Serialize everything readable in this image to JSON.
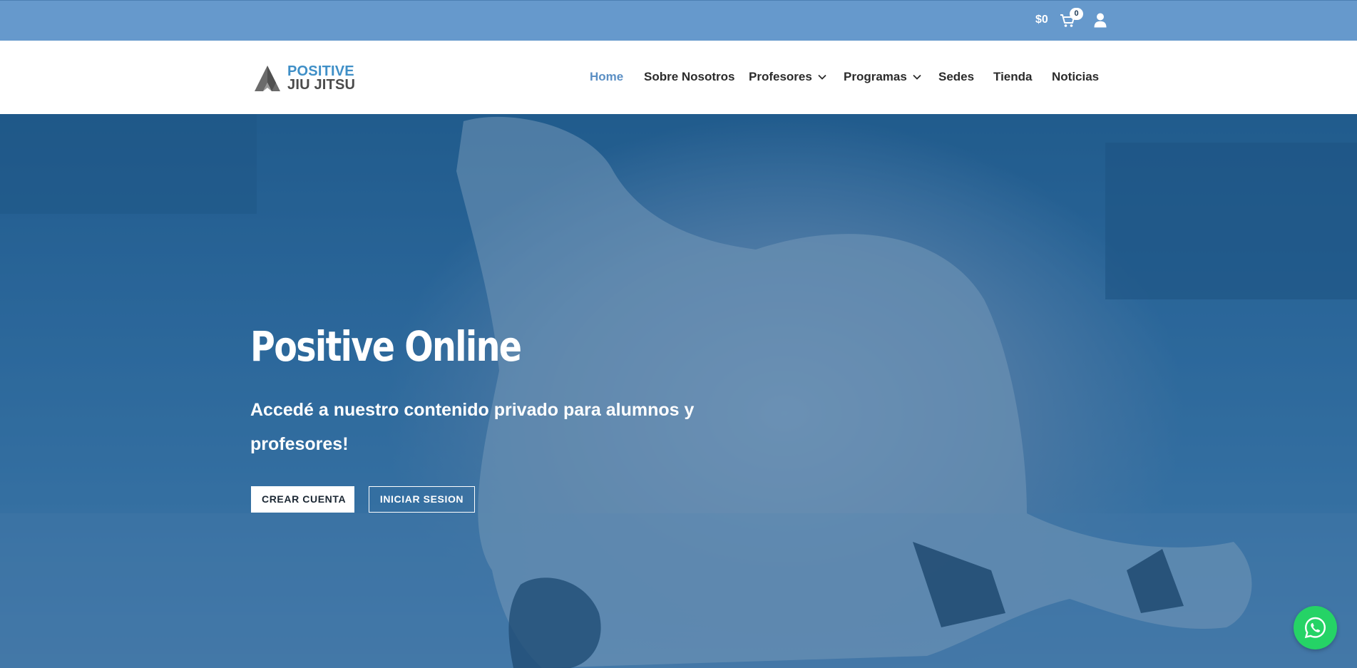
{
  "topbar": {
    "cart_amount": "$0",
    "cart_count": "0",
    "icons": [
      "cart-icon",
      "user-icon"
    ]
  },
  "logo": {
    "line1": "POSITIVE",
    "line2": "JIU JITSU"
  },
  "nav": {
    "items": [
      {
        "label": "Home",
        "active": true
      },
      {
        "label": "Sobre Nosotros"
      },
      {
        "label": "Profesores",
        "dropdown": true
      },
      {
        "label": "Programas",
        "dropdown": true
      },
      {
        "label": "Sedes"
      },
      {
        "label": "Tienda"
      },
      {
        "label": "Noticias"
      }
    ]
  },
  "hero": {
    "title": "Positive Online",
    "subtitle": "Accedé a nuestro contenido privado para alumnos y profesores!",
    "primary_button": "CREAR CUENTA",
    "secondary_button": "INICIAR SESION"
  },
  "colors": {
    "topbar": "#6699cc",
    "accent": "#5b8fc4",
    "hero_tint": "#2d6a9d",
    "whatsapp": "#25d366"
  },
  "floating": {
    "whatsapp_icon": "whatsapp-icon"
  }
}
